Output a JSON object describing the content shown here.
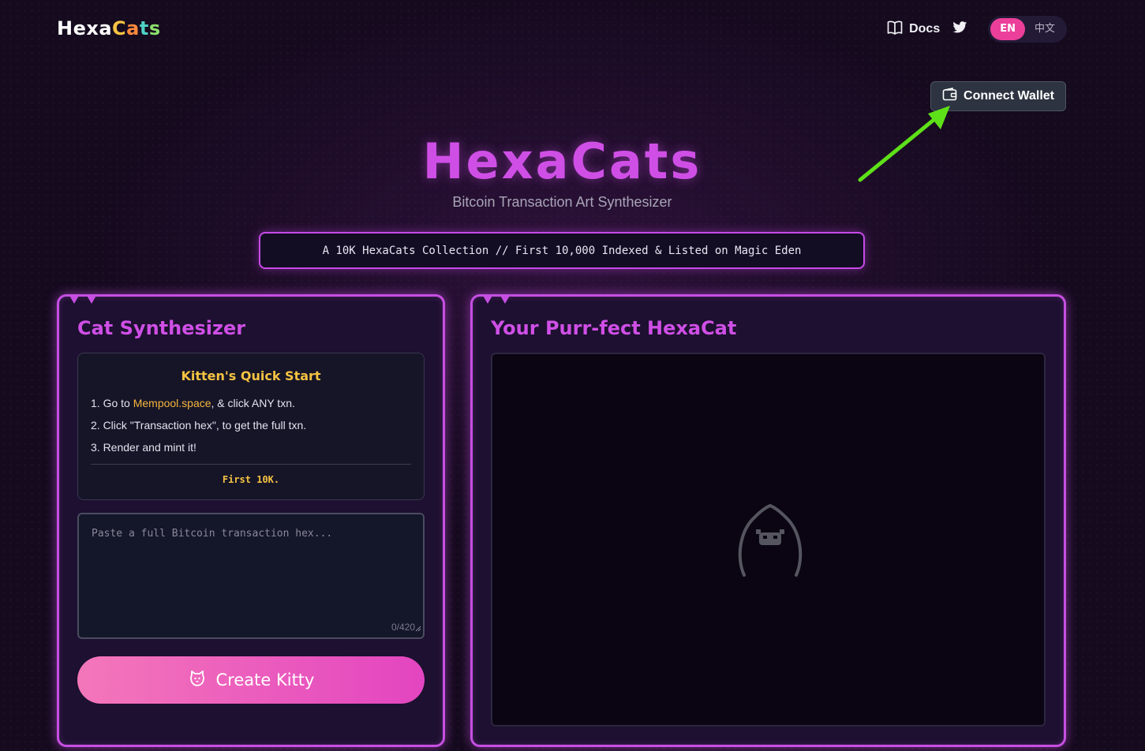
{
  "header": {
    "logo": {
      "part1": "Hexa",
      "c1": "C",
      "c2": "a",
      "c3": "t",
      "c4": "s"
    },
    "docs_label": "Docs",
    "twitter_icon": "twitter-icon",
    "languages": [
      {
        "label": "EN",
        "active": true
      },
      {
        "label": "中文",
        "active": false
      }
    ],
    "connect_wallet_label": "Connect Wallet"
  },
  "hero": {
    "title": "HexaCats",
    "subtitle": "Bitcoin Transaction Art Synthesizer",
    "banner": "A 10K HexaCats Collection // First 10,000 Indexed & Listed on Magic Eden"
  },
  "synthesizer": {
    "title": "Cat Synthesizer",
    "quick_start": {
      "title": "Kitten's Quick Start",
      "step1_prefix": "1. Go to ",
      "step1_link": "Mempool.space",
      "step1_suffix": ", & click ANY txn.",
      "step2": "2. Click \"Transaction hex\", to get the full txn.",
      "step3": "3. Render and mint it!",
      "footer": "First 10K."
    },
    "input": {
      "placeholder": "Paste a full Bitcoin transaction hex...",
      "value": "",
      "counter": "0/420"
    },
    "create_label": "Create Kitty"
  },
  "preview": {
    "title": "Your Purr-fect HexaCat",
    "placeholder_icon": "cat-placeholder-icon"
  },
  "colors": {
    "accent_purple": "#cf4fe6",
    "accent_pink": "#ec3f9a",
    "gold": "#f5c342",
    "annotation_arrow": "#5ee019"
  }
}
